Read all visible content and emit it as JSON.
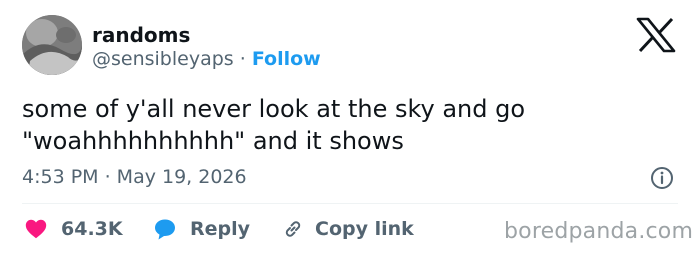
{
  "user": {
    "display_name": "randoms",
    "handle": "@sensibleyaps",
    "separator": "·",
    "follow_label": "Follow"
  },
  "tweet": {
    "text": "some of y'all never look at the sky and go \"woahhhhhhhhhh\" and it shows",
    "timestamp": "4:53 PM · May 19, 2026"
  },
  "actions": {
    "like_count": "64.3K",
    "reply_label": "Reply",
    "copy_link_label": "Copy link"
  },
  "watermark": "boredpanda.com",
  "colors": {
    "like": "#f91880",
    "reply": "#1d9bf0",
    "follow": "#1d9bf0",
    "secondary_text": "#536471",
    "primary_text": "#0f1419"
  },
  "icons": {
    "brand": "x-logo-icon",
    "info": "info-icon",
    "like": "heart-icon",
    "reply": "speech-bubble-icon",
    "copy_link": "link-icon"
  }
}
